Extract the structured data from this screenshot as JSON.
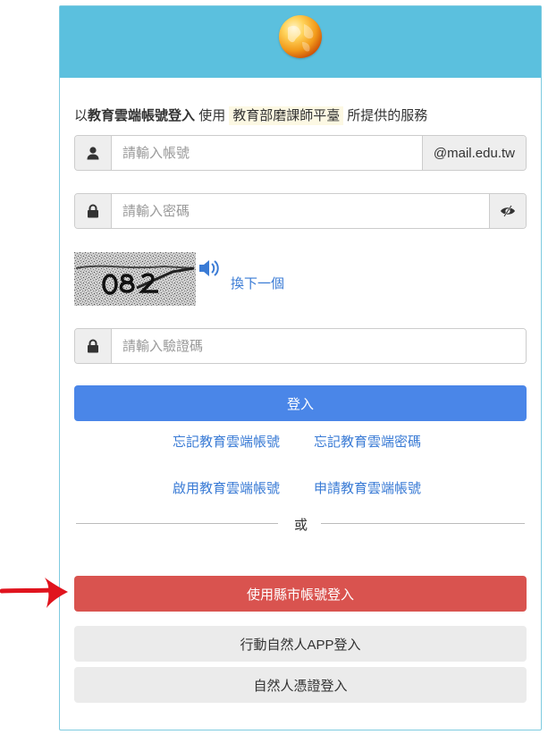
{
  "intro": {
    "prefix": "以",
    "bold": "教育雲端帳號登入",
    "middle": "使用",
    "platform": "教育部磨課師平臺",
    "suffix": "所提供的服務"
  },
  "account": {
    "placeholder": "請輸入帳號",
    "domain": "@mail.edu.tw"
  },
  "password": {
    "placeholder": "請輸入密碼"
  },
  "captcha": {
    "next_label": "換下一個",
    "placeholder": "請輸入驗證碼"
  },
  "buttons": {
    "login": "登入",
    "county_login": "使用縣市帳號登入",
    "app_login": "行動自然人APP登入",
    "cert_login": "自然人憑證登入"
  },
  "links": {
    "forgot_account": "忘記教育雲端帳號",
    "forgot_password": "忘記教育雲端密碼",
    "activate_account": "啟用教育雲端帳號",
    "apply_account": "申請教育雲端帳號"
  },
  "divider": {
    "or": "或"
  },
  "colors": {
    "header": "#5bc0de",
    "primary": "#4a86e8",
    "danger": "#d9534f",
    "arrow": "#e0141e"
  }
}
